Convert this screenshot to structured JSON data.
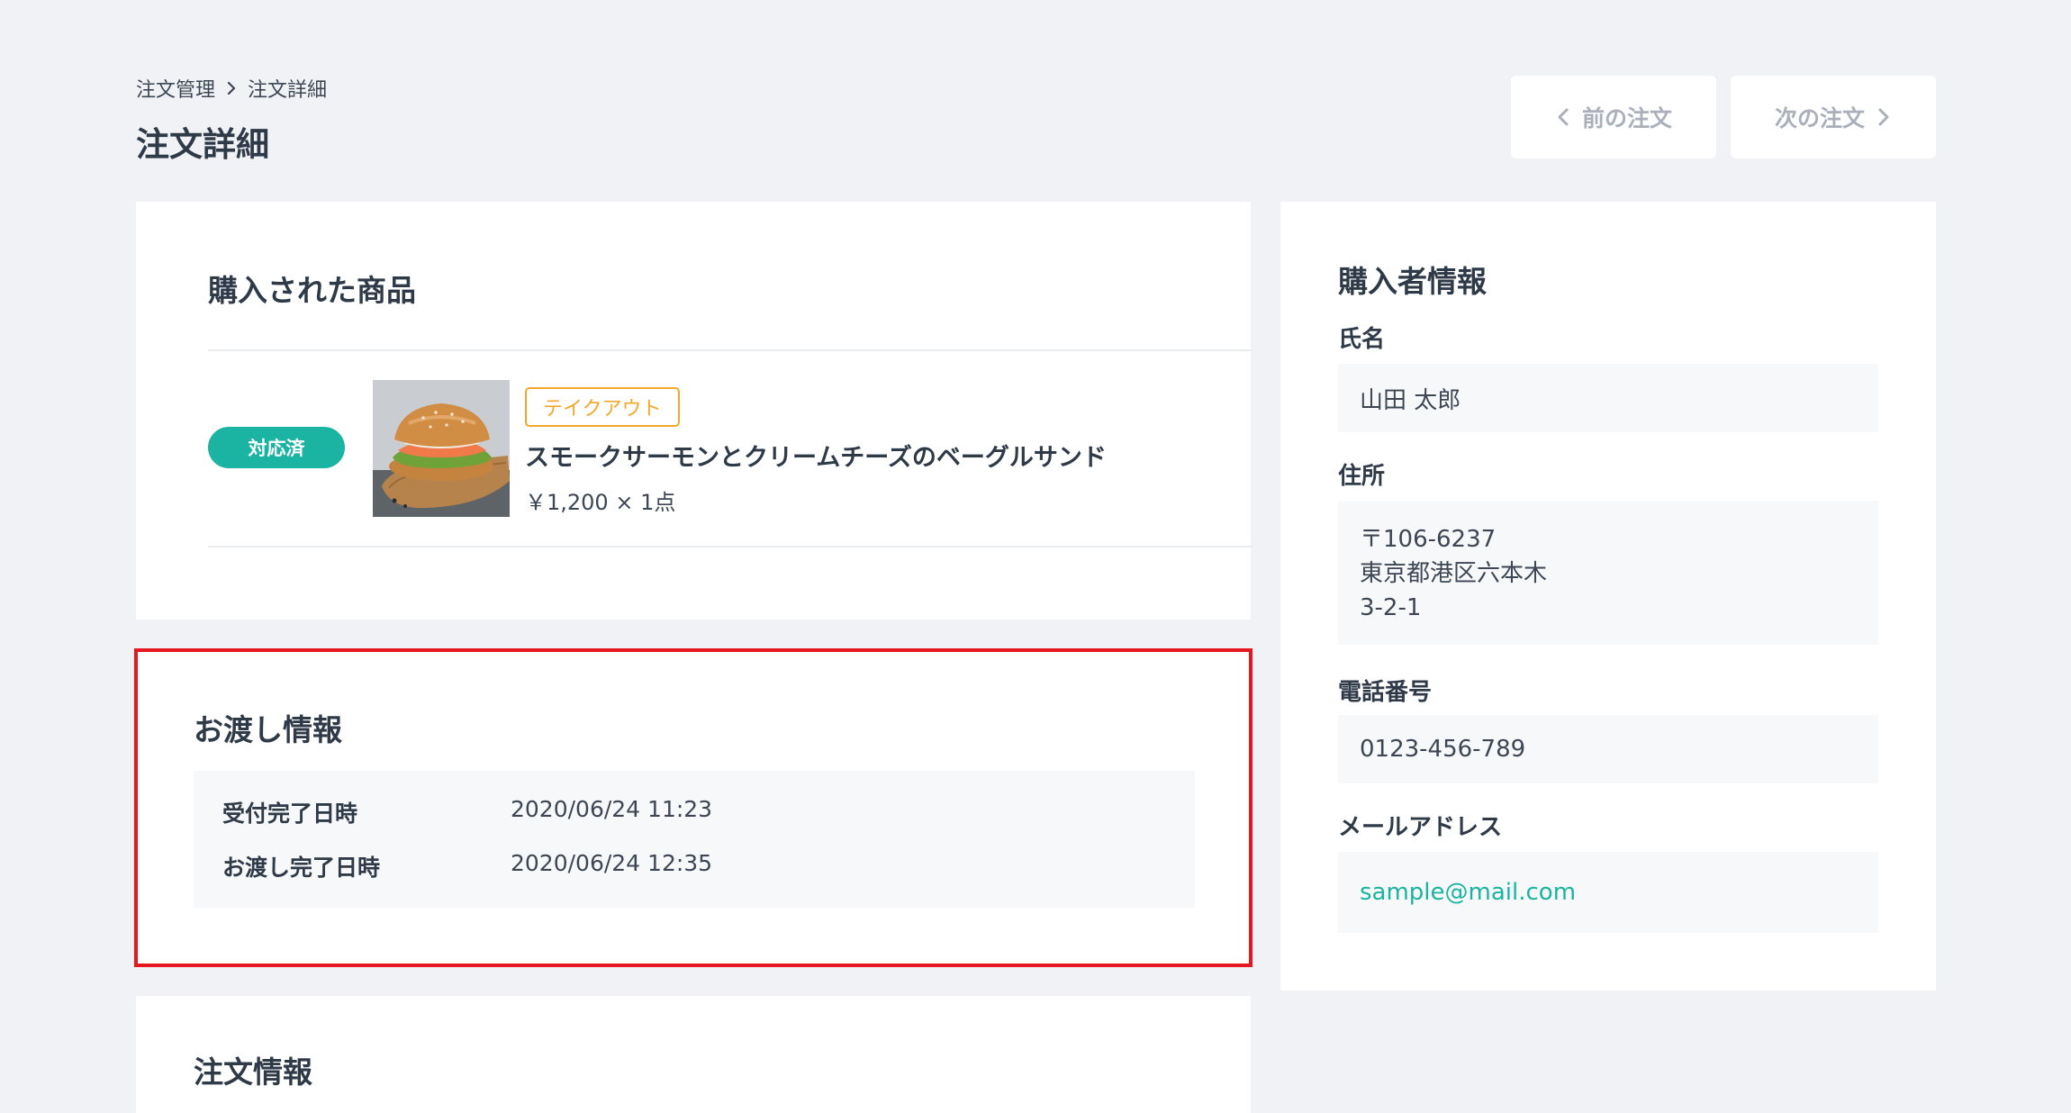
{
  "breadcrumb": {
    "parent": "注文管理",
    "current": "注文詳細"
  },
  "page_title": "注文詳細",
  "nav": {
    "prev_label": "前の注文",
    "next_label": "次の注文"
  },
  "products": {
    "title": "購入された商品",
    "items": [
      {
        "status": "対応済",
        "tag": "テイクアウト",
        "name": "スモークサーモンとクリームチーズのベーグルサンド",
        "price": "￥1,200 × 1点"
      }
    ]
  },
  "delivery": {
    "title": "お渡し情報",
    "rows": [
      {
        "label": "受付完了日時",
        "value": "2020/06/24 11:23"
      },
      {
        "label": "お渡し完了日時",
        "value": "2020/06/24 12:35"
      }
    ]
  },
  "order": {
    "title": "注文情報"
  },
  "buyer": {
    "title": "購入者情報",
    "name_label": "氏名",
    "name": "山田 太郎",
    "address_label": "住所",
    "address_lines": [
      "〒106-6237",
      "東京都港区六本木",
      "3-2-1"
    ],
    "tel_label": "電話番号",
    "tel": "0123-456-789",
    "email_label": "メールアドレス",
    "email": "sample@mail.com"
  },
  "colors": {
    "accent": "#1bb3a1",
    "tag": "#f3a82b",
    "highlight": "#e5171f",
    "background": "#f0f2f5"
  },
  "icons": {
    "breadcrumb_separator": "chevron-right-icon",
    "prev": "chevron-left-icon",
    "next": "chevron-right-icon"
  }
}
